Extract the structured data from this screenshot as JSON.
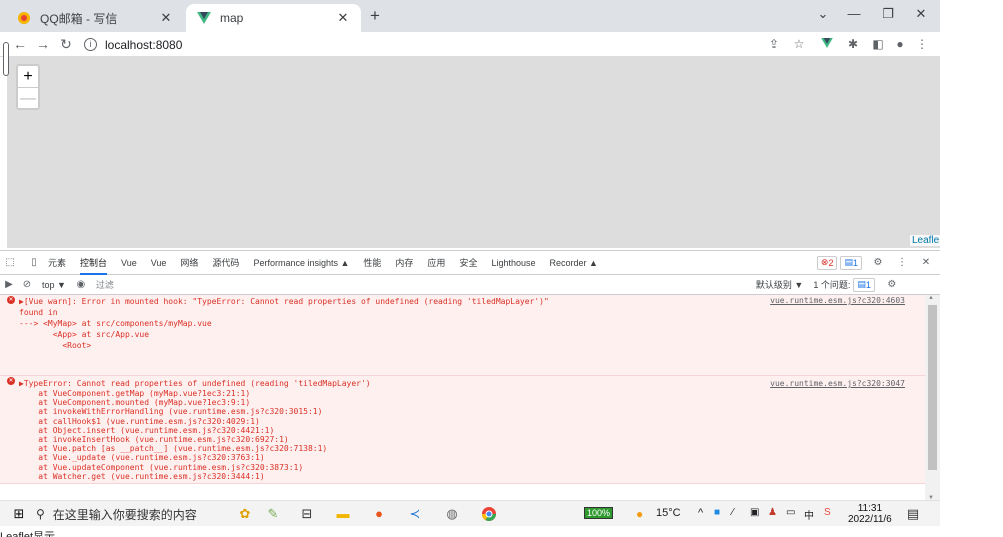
{
  "browser": {
    "tabs": [
      {
        "title": "QQ邮箱 - 写信",
        "favicon": "qq-mail-icon",
        "close": "✕"
      },
      {
        "title": "map",
        "favicon": "vue-icon",
        "close": "✕"
      }
    ],
    "new_tab": "+",
    "window_controls": [
      "⌄",
      "—",
      "❐",
      "✕"
    ],
    "url": "localhost:8080"
  },
  "map": {
    "zoom_in": "+",
    "zoom_out": "—",
    "attribution": "Leafle"
  },
  "devtools": {
    "tabs": [
      "元素",
      "控制台",
      "Vue",
      "Vue",
      "网络",
      "源代码",
      "Performance insights ▲",
      "性能",
      "内存",
      "应用",
      "安全",
      "Lighthouse",
      "Recorder ▲"
    ],
    "active_tab": "控制台",
    "error_count": "2",
    "message_count": "1",
    "context": "top ▼",
    "filter_placeholder": "过滤",
    "levels": "默认级别 ▼",
    "issues": "1 个问题:",
    "issues_count": "1",
    "messages": [
      {
        "lines": [
          "▶[Vue warn]: Error in mounted hook: \"TypeError: Cannot read properties of undefined (reading 'tiledMapLayer')\"",
          "",
          "found in",
          "",
          "---> <MyMap> at src/components/myMap.vue",
          "       <App> at src/App.vue",
          "         <Root>"
        ],
        "source": "vue.runtime.esm.js?c320:4603"
      },
      {
        "lines": [
          "▶TypeError: Cannot read properties of undefined (reading 'tiledMapLayer')",
          "    at VueComponent.getMap (myMap.vue?1ec3:21:1)",
          "    at VueComponent.mounted (myMap.vue?1ec3:9:1)",
          "    at invokeWithErrorHandling (vue.runtime.esm.js?c320:3015:1)",
          "    at callHook$1 (vue.runtime.esm.js?c320:4029:1)",
          "    at Object.insert (vue.runtime.esm.js?c320:4421:1)",
          "    at invokeInsertHook (vue.runtime.esm.js?c320:6927:1)",
          "    at Vue.patch [as __patch__] (vue.runtime.esm.js?c320:7138:1)",
          "    at Vue._update (vue.runtime.esm.js?c320:3763:1)",
          "    at Vue.updateComponent (vue.runtime.esm.js?c320:3873:1)",
          "    at Watcher.get (vue.runtime.esm.js?c320:3444:1)"
        ],
        "source": "vue.runtime.esm.js?c320:3047"
      }
    ]
  },
  "taskbar": {
    "search_placeholder": "在这里输入你要搜索的内容",
    "battery": "100%",
    "weather": "15°C",
    "time": "11:31",
    "date": "2022/11/6"
  },
  "footer_text": "Leaflet显示"
}
